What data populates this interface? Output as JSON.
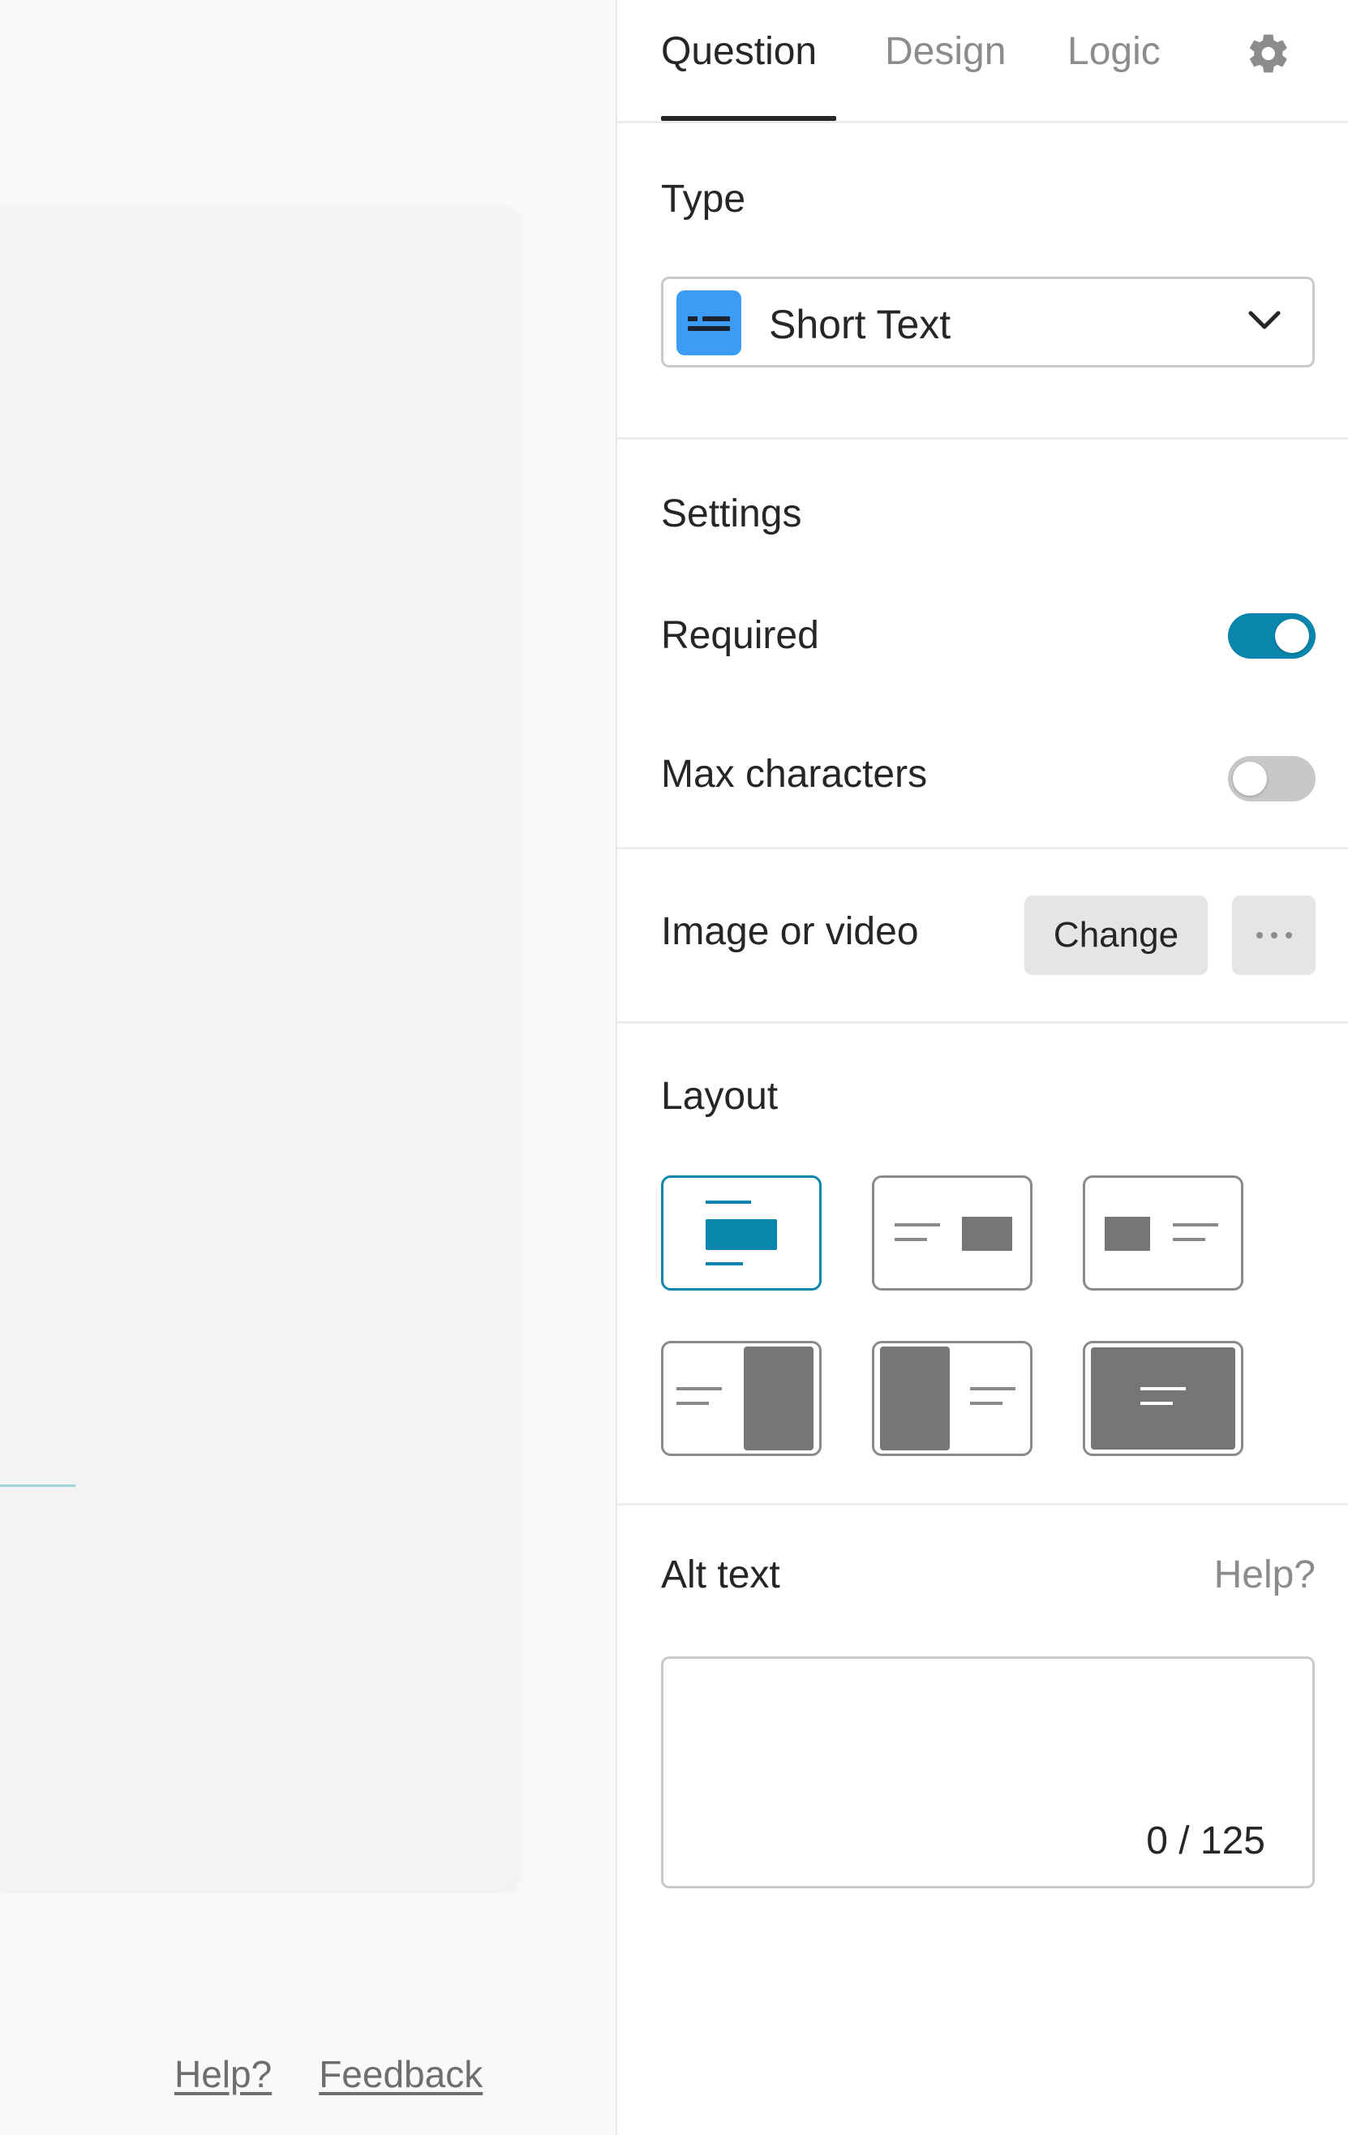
{
  "footer": {
    "help_link": "Help?",
    "feedback_link": "Feedback"
  },
  "tabs": [
    {
      "label": "Question",
      "active": true
    },
    {
      "label": "Design",
      "active": false
    },
    {
      "label": "Logic",
      "active": false
    }
  ],
  "settings_icon": "gear-icon",
  "type_section": {
    "title": "Type",
    "selected_type": "Short Text",
    "icon": "short-text-icon",
    "icon_color": "#3c9cf5"
  },
  "settings_section": {
    "title": "Settings",
    "required": {
      "label": "Required",
      "enabled": true
    },
    "max_characters": {
      "label": "Max characters",
      "enabled": false
    }
  },
  "media_section": {
    "title": "Image or video",
    "change_label": "Change",
    "more_icon": "more-horizontal-icon"
  },
  "layout_section": {
    "title": "Layout",
    "options": [
      {
        "name": "stack-top",
        "selected": true
      },
      {
        "name": "split-media-right-small",
        "selected": false
      },
      {
        "name": "split-media-left-small",
        "selected": false
      },
      {
        "name": "split-media-right-full",
        "selected": false
      },
      {
        "name": "split-media-left-full",
        "selected": false
      },
      {
        "name": "wallpaper",
        "selected": false
      }
    ]
  },
  "alt_text_section": {
    "title": "Alt text",
    "help_label": "Help?",
    "value": "",
    "counter": "0 / 125"
  },
  "colors": {
    "accent": "#0a86ad",
    "toggle_off": "#c8c8c8",
    "text": "#262627",
    "muted": "#8c8c8c"
  }
}
